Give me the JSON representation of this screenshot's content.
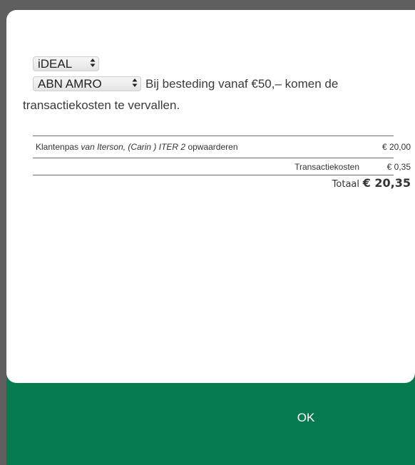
{
  "payment": {
    "method_value": "iDEAL",
    "bank_value": "ABN AMRO",
    "notice_part1": "Bij besteding vanaf €50,– komen de",
    "notice_part2": "transactiekosten te vervallen."
  },
  "order": {
    "item": {
      "prefix": "Klantenpas ",
      "name": "van Iterson, (Carin ) ITER 2",
      "suffix": " opwaarderen",
      "amount": "€ 20,00"
    },
    "fee": {
      "label": "Transactiekosten",
      "amount": "€ 0,35"
    },
    "total": {
      "label": "Totaal",
      "amount": "€ 20,35"
    }
  },
  "footer": {
    "ok_label": "OK"
  },
  "colors": {
    "footer_green": "#067a4f",
    "backdrop": "#5f5f5f"
  },
  "icons": {
    "select_arrows": "updown-arrows-icon"
  }
}
